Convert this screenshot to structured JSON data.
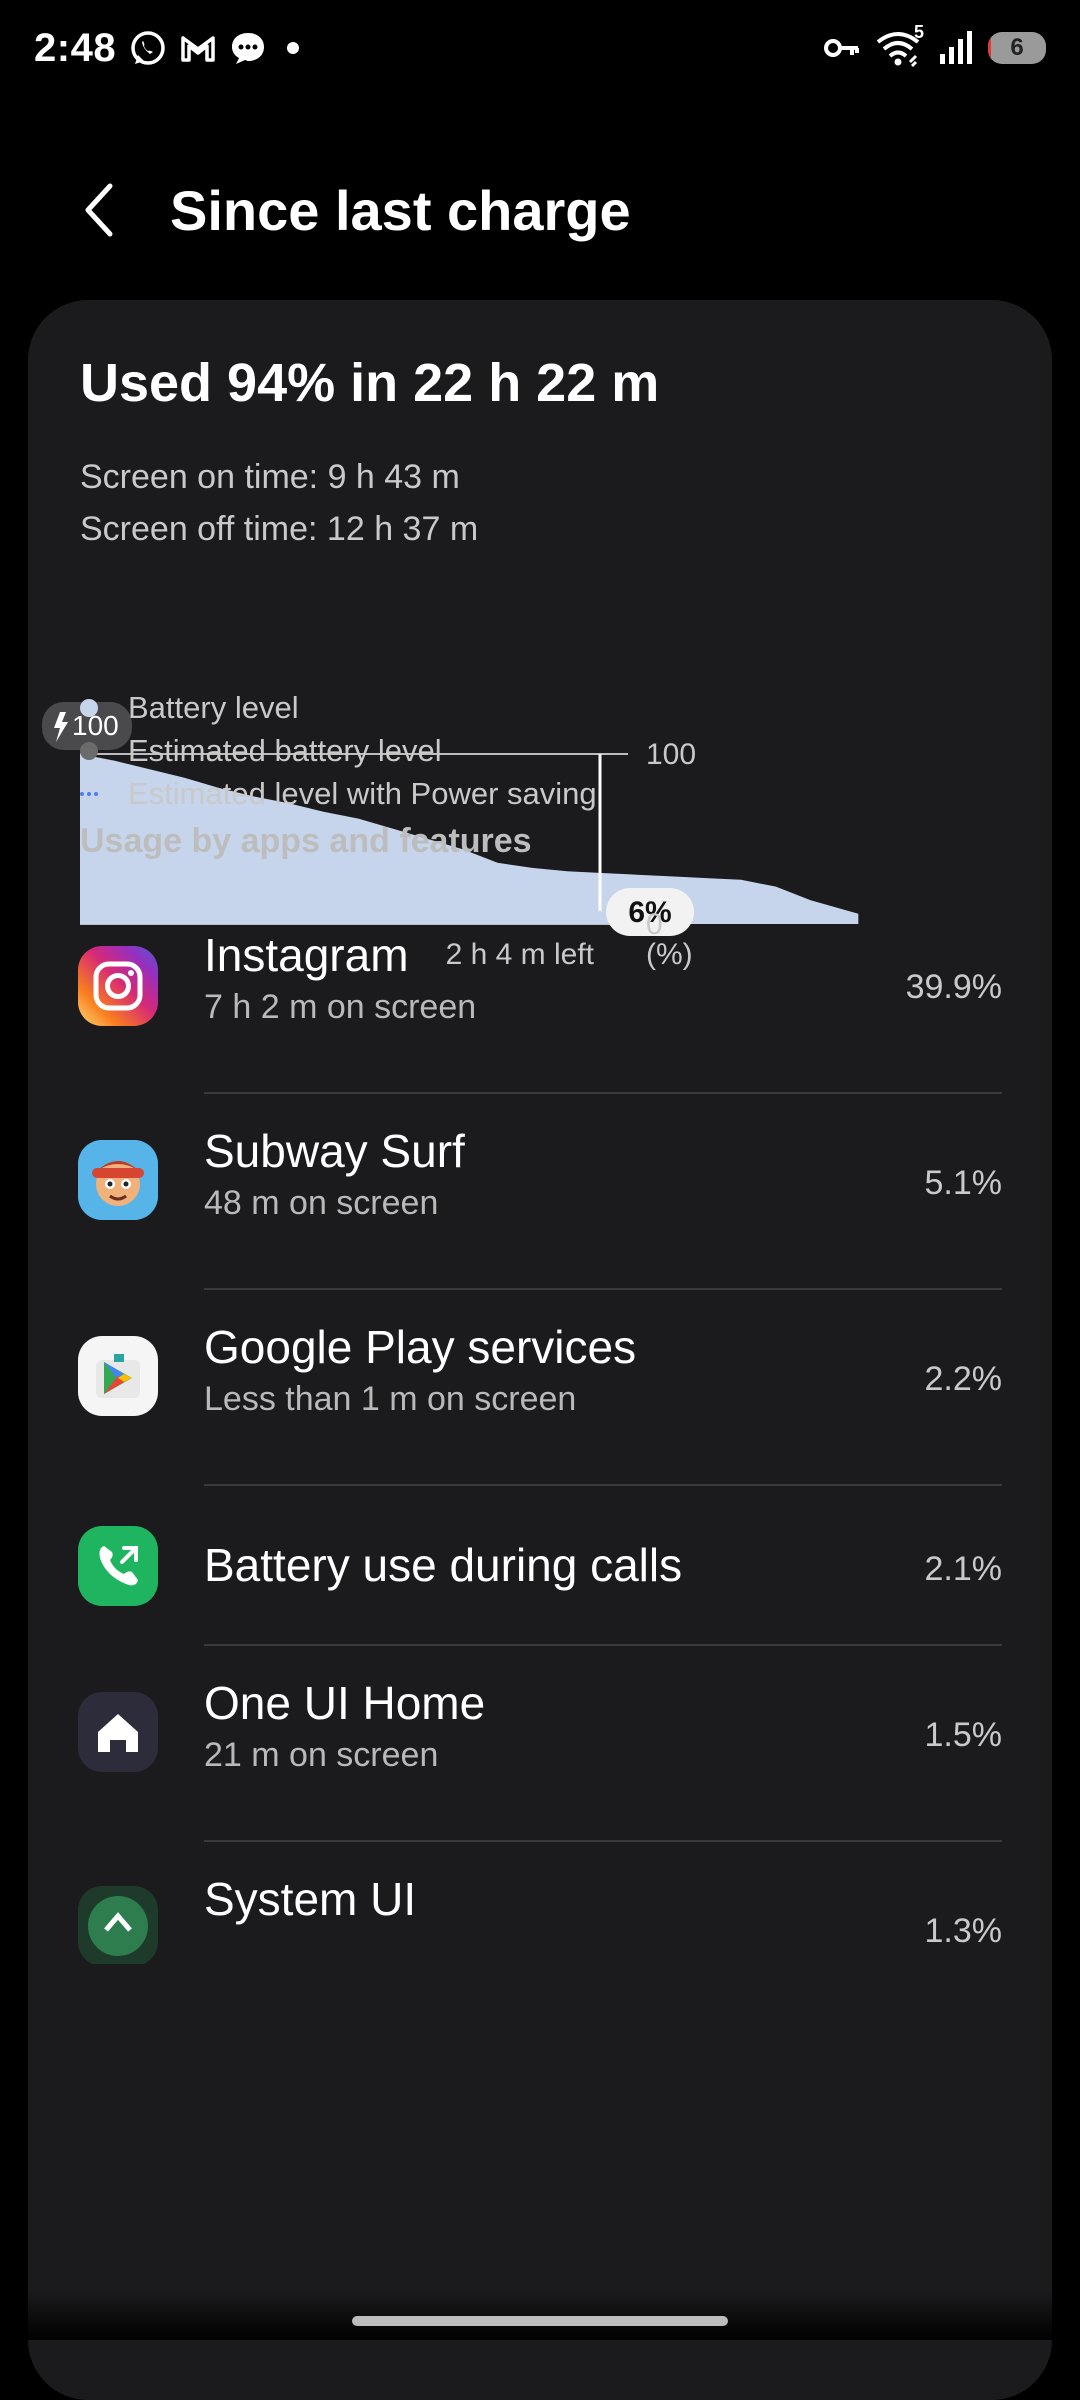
{
  "status_bar": {
    "time": "2:48",
    "left_icons": [
      "whatsapp-icon",
      "gmail-icon",
      "messages-icon",
      "dot-icon"
    ],
    "right_icons": [
      "vpn-key-icon",
      "wifi-icon",
      "signal-icon"
    ],
    "wifi_label": "5",
    "battery_level": "6",
    "battery_fraction": 0.06
  },
  "header": {
    "title": "Since last charge"
  },
  "summary": {
    "used": "Used 94% in 22 h 22 m",
    "screen_on": "Screen on time: 9 h 43 m",
    "screen_off": "Screen off time: 12 h 37 m"
  },
  "chart_data": {
    "type": "area",
    "title": "",
    "xlabel": "",
    "ylabel": "(%)",
    "ylim": [
      0,
      100
    ],
    "y_tick_labels": [
      "100",
      "0"
    ],
    "start_badge": "100",
    "current_badge": "6%",
    "time_left_label": "2 h 4 m left",
    "x_hours": [
      0,
      1,
      2,
      3,
      4,
      5,
      6,
      7,
      8,
      9,
      10,
      11,
      12,
      13,
      14,
      15,
      16,
      17,
      18,
      19,
      20,
      21,
      22.37
    ],
    "y": [
      100,
      96,
      91,
      86,
      80,
      75,
      71,
      66,
      62,
      56,
      50,
      44,
      36,
      33,
      31,
      30,
      29,
      28,
      27,
      26,
      22,
      14,
      6
    ],
    "x_total_hours": 24.43,
    "series": [
      {
        "name": "Battery level",
        "color": "#c6d5ec"
      },
      {
        "name": "Estimated battery level",
        "color": "#6b6b6b"
      },
      {
        "name": "Estimated level with Power saving",
        "color": "#4c7ef0"
      }
    ],
    "legend_position": "bottom-left",
    "grid": false
  },
  "section_title": "Usage by apps and features",
  "apps": [
    {
      "name": "Instagram",
      "sub": "7 h 2 m on screen",
      "pct": "39.9%",
      "icon": "instagram-icon"
    },
    {
      "name": "Subway Surf",
      "sub": "48 m on screen",
      "pct": "5.1%",
      "icon": "subway-surf-icon"
    },
    {
      "name": "Google Play services",
      "sub": "Less than 1 m on screen",
      "pct": "2.2%",
      "icon": "google-play-services-icon"
    },
    {
      "name": "Battery use during calls",
      "sub": "",
      "pct": "2.1%",
      "icon": "phone-icon"
    },
    {
      "name": "One UI Home",
      "sub": "21 m on screen",
      "pct": "1.5%",
      "icon": "home-icon"
    },
    {
      "name": "System UI",
      "sub": "",
      "pct": "1.3%",
      "icon": "system-ui-icon"
    }
  ]
}
